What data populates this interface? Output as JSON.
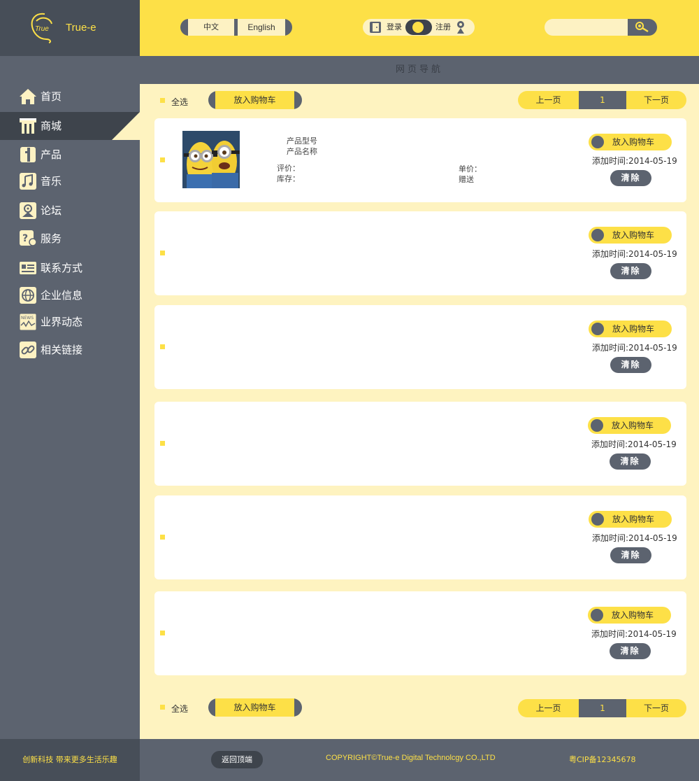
{
  "brand": {
    "name": "True-e",
    "logo_text": "True"
  },
  "header": {
    "lang_cn": "中文",
    "lang_en": "English",
    "login_label": "登录",
    "register_label": "注册",
    "search_placeholder": ""
  },
  "sidebar": {
    "items": [
      {
        "label": "首页",
        "icon": "home-icon"
      },
      {
        "label": "商城",
        "icon": "shop-icon",
        "active": true
      },
      {
        "label": "产品",
        "icon": "product-icon"
      },
      {
        "label": "音乐",
        "icon": "music-icon"
      },
      {
        "label": "论坛",
        "icon": "forum-icon"
      },
      {
        "label": "服务",
        "icon": "service-icon"
      },
      {
        "label": "联系方式",
        "icon": "contact-icon"
      },
      {
        "label": "企业信息",
        "icon": "globe-icon"
      },
      {
        "label": "业界动态",
        "icon": "news-icon"
      },
      {
        "label": "相关链接",
        "icon": "link-icon"
      }
    ]
  },
  "pagenav": {
    "title": "网页导航"
  },
  "toolbar": {
    "select_all": "全选",
    "add_to_cart": "放入购物车",
    "prev": "上一页",
    "page": "1",
    "next": "下一页"
  },
  "cards": [
    {
      "has_product": true,
      "model_label": "产品型号",
      "name_label": "产品名称",
      "rating_label": "评价：",
      "stock_label": "库存：",
      "price_label": "单价：",
      "gift_label": "赠送",
      "add_cart": "放入购物车",
      "added_time": "添加时间:2014-05-19",
      "clear": "清除"
    },
    {
      "has_product": false,
      "add_cart": "放入购物车",
      "added_time": "添加时间:2014-05-19",
      "clear": "清除"
    },
    {
      "has_product": false,
      "add_cart": "放入购物车",
      "added_time": "添加时间:2014-05-19",
      "clear": "清除"
    },
    {
      "has_product": false,
      "add_cart": "放入购物车",
      "added_time": "添加时间:2014-05-19",
      "clear": "清除"
    },
    {
      "has_product": false,
      "add_cart": "放入购物车",
      "added_time": "添加时间:2014-05-19",
      "clear": "清除"
    },
    {
      "has_product": false,
      "add_cart": "放入购物车",
      "added_time": "添加时间:2014-05-19",
      "clear": "清除"
    }
  ],
  "footer": {
    "slogan": "创新科技 带来更多生活乐趣",
    "back_top": "返回顶端",
    "copyright": "COPYRIGHT©True-e Digital Technolcgy CO.,LTD",
    "icp": "粤CIP备12345678"
  },
  "colors": {
    "accent": "#fde047",
    "dark": "#474e58",
    "sidebar": "#5c636f",
    "background": "#fef3c0"
  }
}
